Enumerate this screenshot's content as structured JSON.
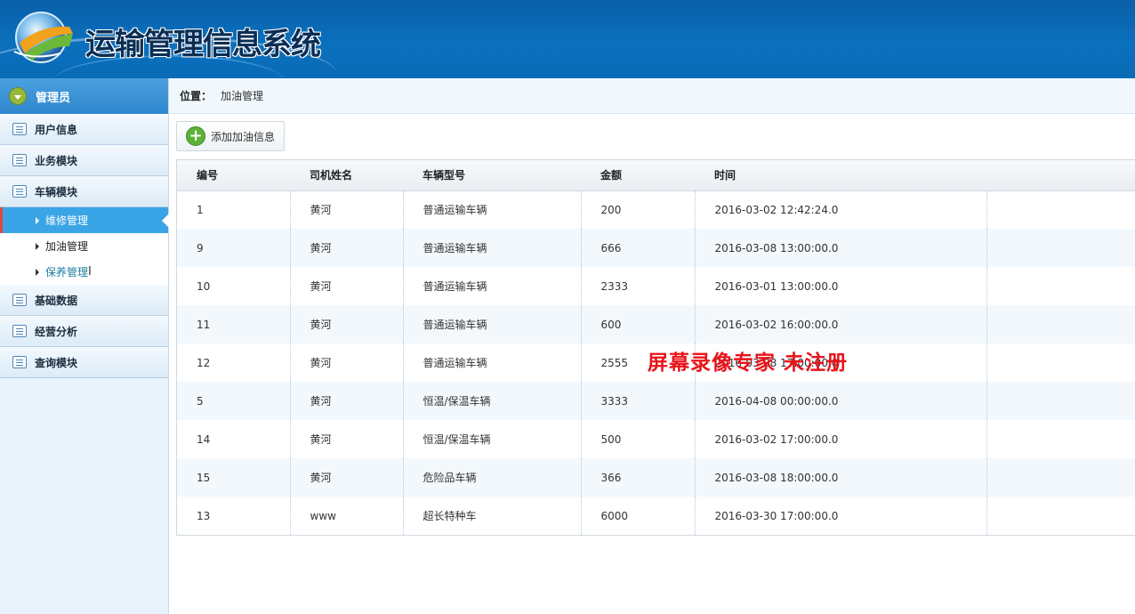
{
  "header": {
    "title": "运输管理信息系统"
  },
  "sidebar": {
    "role": "管理员",
    "menu": [
      {
        "label": "用户信息"
      },
      {
        "label": "业务模块"
      },
      {
        "label": "车辆模块"
      }
    ],
    "sub_items": [
      {
        "label": "维修管理"
      },
      {
        "label": "加油管理"
      },
      {
        "label": "保养管理"
      }
    ],
    "menu_after": [
      {
        "label": "基础数据"
      },
      {
        "label": "经营分析"
      },
      {
        "label": "查询模块"
      }
    ]
  },
  "breadcrumb": {
    "label": "位置：",
    "current": "加油管理"
  },
  "toolbar": {
    "add_label": "添加加油信息"
  },
  "table": {
    "headers": [
      "编号",
      "司机姓名",
      "车辆型号",
      "金额",
      "时间",
      ""
    ],
    "rows": [
      [
        "1",
        "黄河",
        "普通运输车辆",
        "200",
        "2016-03-02 12:42:24.0"
      ],
      [
        "9",
        "黄河",
        "普通运输车辆",
        "666",
        "2016-03-08 13:00:00.0"
      ],
      [
        "10",
        "黄河",
        "普通运输车辆",
        "2333",
        "2016-03-01 13:00:00.0"
      ],
      [
        "11",
        "黄河",
        "普通运输车辆",
        "600",
        "2016-03-02 16:00:00.0"
      ],
      [
        "12",
        "黄河",
        "普通运输车辆",
        "2555",
        "2016-03-08 17:00:00.0"
      ],
      [
        "5",
        "黄河",
        "恒温/保温车辆",
        "3333",
        "2016-04-08 00:00:00.0"
      ],
      [
        "14",
        "黄河",
        "恒温/保温车辆",
        "500",
        "2016-03-02 17:00:00.0"
      ],
      [
        "15",
        "黄河",
        "危险品车辆",
        "366",
        "2016-03-08 18:00:00.0"
      ],
      [
        "13",
        "www",
        "超长特种车",
        "6000",
        "2016-03-30 17:00:00.0"
      ]
    ]
  },
  "watermark": "屏幕录像专家  未注册"
}
